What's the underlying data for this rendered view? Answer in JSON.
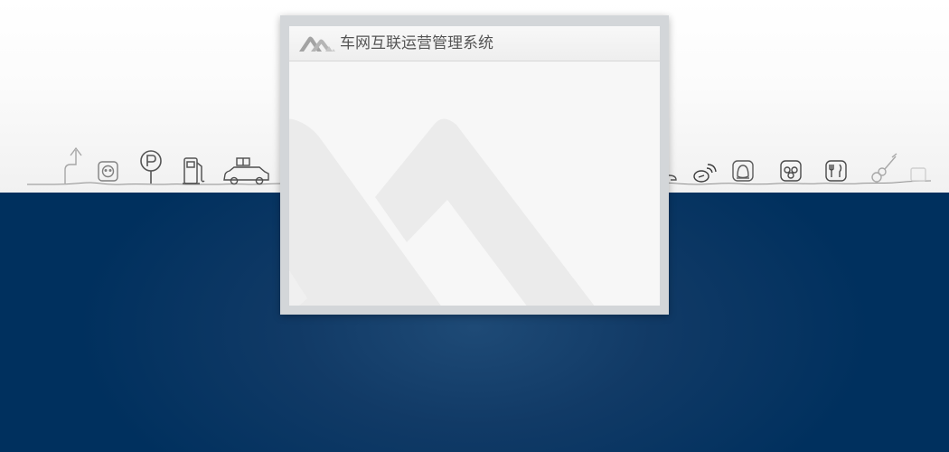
{
  "dialog": {
    "title": "车网互联运营管理系统"
  },
  "icons": [
    "turn-arrow-icon",
    "power-outlet-icon",
    "parking-sign-icon",
    "fuel-pump-icon",
    "taxi-icon",
    "satellite-dish-icon",
    "qq-icon",
    "group-chat-icon",
    "restaurant-icon",
    "guitar-icon"
  ],
  "colors": {
    "background_top": "#ffffff",
    "background_bottom": "#00305e",
    "dialog_frame": "#d3d6d9",
    "dialog_body": "#f7f7f7",
    "title_text": "#555555"
  }
}
